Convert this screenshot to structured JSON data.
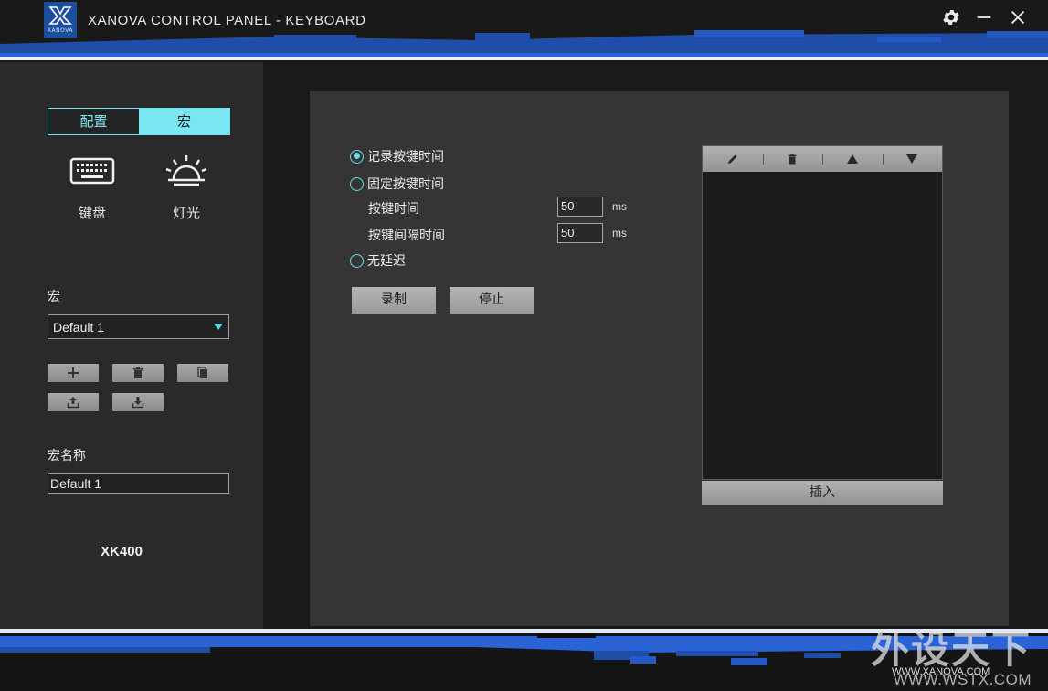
{
  "app": {
    "title": "XANOVA CONTROL PANEL - KEYBOARD",
    "logo_text": "XANOVA",
    "accent_color": "#7ae6f2",
    "brand_blue": "#1d4e9c"
  },
  "window_controls": {
    "icons": [
      "gear-icon",
      "minimize-icon",
      "close-icon"
    ]
  },
  "sidebar": {
    "tabs": [
      {
        "label": "配置",
        "active": false
      },
      {
        "label": "宏",
        "active": true
      }
    ],
    "nav": [
      {
        "label": "键盘",
        "icon": "keyboard-icon"
      },
      {
        "label": "灯光",
        "icon": "light-icon"
      }
    ],
    "macro_label": "宏",
    "macro_select_value": "Default 1",
    "macro_buttons": [
      "plus-icon",
      "trash-icon",
      "copy-icon",
      "upload-icon",
      "download-icon"
    ],
    "macro_name_label": "宏名称",
    "macro_name_value": "Default 1",
    "model": "XK400"
  },
  "main": {
    "options": [
      {
        "label": "记录按键时间",
        "checked": true
      },
      {
        "label": "固定按键时间",
        "checked": false
      },
      {
        "label": "无延迟",
        "checked": false
      }
    ],
    "key_time": {
      "label": "按键时间",
      "value": "50",
      "unit": "ms"
    },
    "key_interval": {
      "label": "按键间隔时间",
      "value": "50",
      "unit": "ms"
    },
    "record_button": "录制",
    "stop_button": "停止",
    "list_toolbar": [
      "edit-icon",
      "trash-icon",
      "arrow-up-icon",
      "arrow-down-icon"
    ],
    "insert_button": "插入"
  },
  "footer": {
    "watermark_title": "外设天下",
    "watermark_url": "WWW.WSTX.COM",
    "url": "WWW.XANOVA.COM"
  }
}
